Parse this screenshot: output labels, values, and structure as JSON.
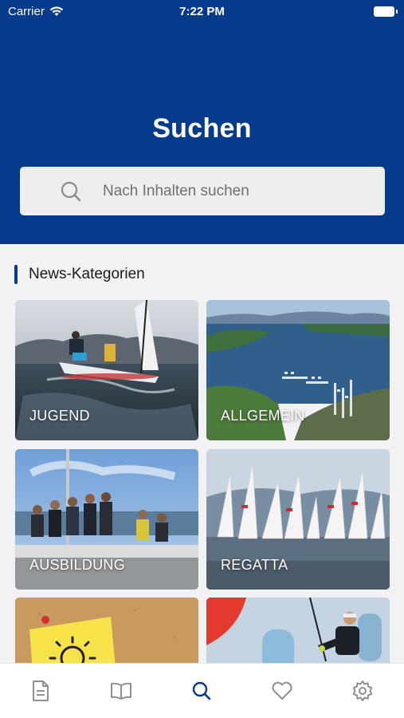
{
  "status_bar": {
    "carrier": "Carrier",
    "time": "7:22 PM"
  },
  "header": {
    "title": "Suchen"
  },
  "search": {
    "placeholder": "Nach Inhalten suchen",
    "value": ""
  },
  "section": {
    "title": "News-Kategorien"
  },
  "categories": [
    {
      "label": "JUGEND",
      "image": "youth-sailing-dinghy"
    },
    {
      "label": "ALLGEMEIN",
      "image": "lake-marina-aerial"
    },
    {
      "label": "AUSBILDUNG",
      "image": "training-group-on-boat"
    },
    {
      "label": "REGATTA",
      "image": "regatta-sails"
    },
    {
      "label": "",
      "image": "corkboard-sticky-note"
    },
    {
      "label": "",
      "image": "sailor-on-board"
    }
  ],
  "tabbar": {
    "items": [
      "document-icon",
      "book-icon",
      "search-icon",
      "heart-icon",
      "settings-icon"
    ],
    "active_index": 2
  },
  "colors": {
    "brand": "#053a8c",
    "active_tab": "#053a8c",
    "inactive_tab": "#8f8f94"
  }
}
